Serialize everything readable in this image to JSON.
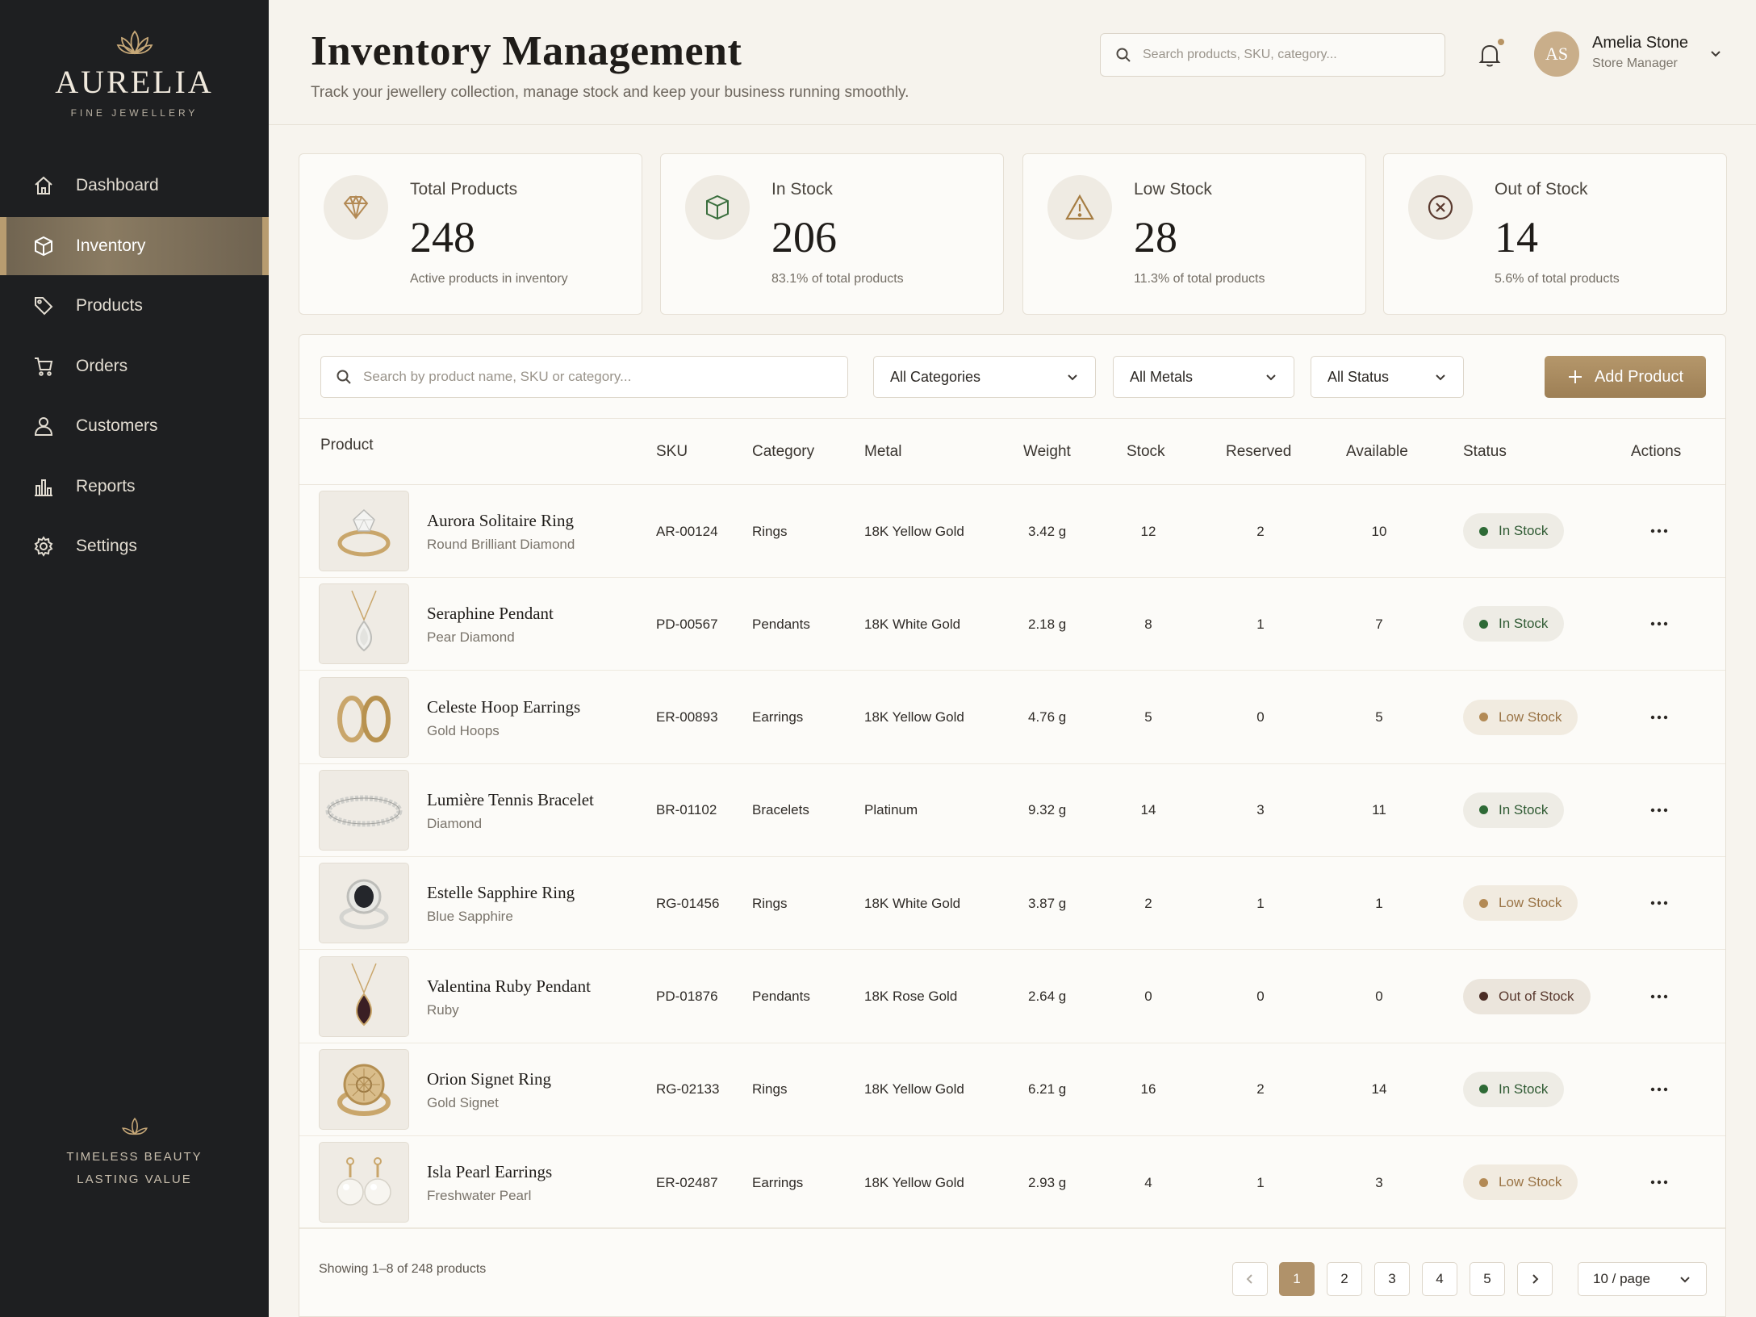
{
  "brand": {
    "name": "AURELIA",
    "tagline": "FINE JEWELLERY",
    "footer_line1": "TIMELESS BEAUTY",
    "footer_line2": "LASTING VALUE",
    "accent": "#b0926a"
  },
  "sidebar": {
    "items": [
      {
        "label": "Dashboard",
        "icon": "home-icon",
        "active": false
      },
      {
        "label": "Inventory",
        "icon": "box-icon",
        "active": true
      },
      {
        "label": "Products",
        "icon": "tag-icon",
        "active": false
      },
      {
        "label": "Orders",
        "icon": "cart-icon",
        "active": false
      },
      {
        "label": "Customers",
        "icon": "user-icon",
        "active": false
      },
      {
        "label": "Reports",
        "icon": "bar-chart-icon",
        "active": false
      },
      {
        "label": "Settings",
        "icon": "gear-icon",
        "active": false
      }
    ]
  },
  "header": {
    "title": "Inventory Management",
    "subtitle": "Track your jewellery collection, manage stock and keep your business running smoothly.",
    "search_placeholder": "Search products, SKU, category...",
    "user": {
      "initials": "AS",
      "name": "Amelia Stone",
      "role": "Store Manager"
    }
  },
  "stats": [
    {
      "label": "Total Products",
      "value": "248",
      "note": "Active products in inventory",
      "icon": "diamond-icon"
    },
    {
      "label": "In Stock",
      "value": "206",
      "note": "83.1% of total products",
      "icon": "box-icon"
    },
    {
      "label": "Low Stock",
      "value": "28",
      "note": "11.3% of total products",
      "icon": "warning-icon"
    },
    {
      "label": "Out of Stock",
      "value": "14",
      "note": "5.6% of total products",
      "icon": "x-circle-icon"
    }
  ],
  "toolbar": {
    "search_placeholder": "Search by product name, SKU or category...",
    "category_filter": "All Categories",
    "metal_filter": "All Metals",
    "status_filter": "All Status",
    "add_label": "Add Product"
  },
  "table": {
    "columns": [
      "Product",
      "SKU",
      "Category",
      "Metal",
      "Weight",
      "Stock",
      "Reserved",
      "Available",
      "Status",
      "Actions"
    ],
    "rows": [
      {
        "name": "Aurora Solitaire Ring",
        "sub": "Round Brilliant Diamond",
        "sku": "AR-00124",
        "category": "Rings",
        "metal": "18K Yellow Gold",
        "weight": "3.42 g",
        "stock": "12",
        "reserved": "2",
        "available": "10",
        "status": "In Stock",
        "status_kind": "in",
        "thumb": "ring-diamond"
      },
      {
        "name": "Seraphine Pendant",
        "sub": "Pear Diamond",
        "sku": "PD-00567",
        "category": "Pendants",
        "metal": "18K White Gold",
        "weight": "2.18 g",
        "stock": "8",
        "reserved": "1",
        "available": "7",
        "status": "In Stock",
        "status_kind": "in",
        "thumb": "pendant-diamond"
      },
      {
        "name": "Celeste Hoop Earrings",
        "sub": "Gold Hoops",
        "sku": "ER-00893",
        "category": "Earrings",
        "metal": "18K Yellow Gold",
        "weight": "4.76 g",
        "stock": "5",
        "reserved": "0",
        "available": "5",
        "status": "Low Stock",
        "status_kind": "low",
        "thumb": "hoops"
      },
      {
        "name": "Lumière Tennis Bracelet",
        "sub": "Diamond",
        "sku": "BR-01102",
        "category": "Bracelets",
        "metal": "Platinum",
        "weight": "9.32 g",
        "stock": "14",
        "reserved": "3",
        "available": "11",
        "status": "In Stock",
        "status_kind": "in",
        "thumb": "bracelet"
      },
      {
        "name": "Estelle Sapphire Ring",
        "sub": "Blue Sapphire",
        "sku": "RG-01456",
        "category": "Rings",
        "metal": "18K White Gold",
        "weight": "3.87 g",
        "stock": "2",
        "reserved": "1",
        "available": "1",
        "status": "Low Stock",
        "status_kind": "low",
        "thumb": "ring-sapphire"
      },
      {
        "name": "Valentina Ruby Pendant",
        "sub": "Ruby",
        "sku": "PD-01876",
        "category": "Pendants",
        "metal": "18K Rose Gold",
        "weight": "2.64 g",
        "stock": "0",
        "reserved": "0",
        "available": "0",
        "status": "Out of Stock",
        "status_kind": "out",
        "thumb": "pendant-ruby"
      },
      {
        "name": "Orion Signet Ring",
        "sub": "Gold Signet",
        "sku": "RG-02133",
        "category": "Rings",
        "metal": "18K Yellow Gold",
        "weight": "6.21 g",
        "stock": "16",
        "reserved": "2",
        "available": "14",
        "status": "In Stock",
        "status_kind": "in",
        "thumb": "signet"
      },
      {
        "name": "Isla Pearl Earrings",
        "sub": "Freshwater Pearl",
        "sku": "ER-02487",
        "category": "Earrings",
        "metal": "18K Yellow Gold",
        "weight": "2.93 g",
        "stock": "4",
        "reserved": "1",
        "available": "3",
        "status": "Low Stock",
        "status_kind": "low",
        "thumb": "pearls"
      }
    ]
  },
  "pagination": {
    "showing": "Showing 1–8 of 248 products",
    "pages": [
      "1",
      "2",
      "3",
      "4",
      "5"
    ],
    "current": "1",
    "per_page": "10 / page"
  }
}
